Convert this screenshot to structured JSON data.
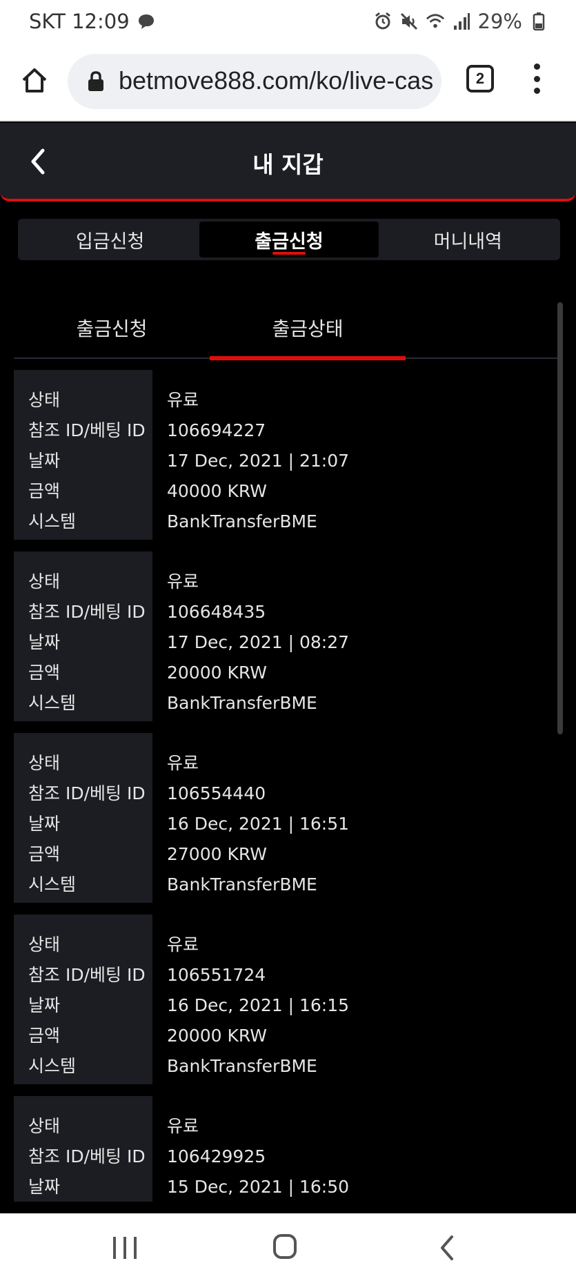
{
  "status_bar": {
    "carrier_time": "SKT 12:09",
    "battery": "29%",
    "icons": [
      "message-icon",
      "alarm-icon",
      "mute-icon",
      "wifi-icon",
      "signal-icon",
      "battery-icon"
    ]
  },
  "browser": {
    "url": "betmove888.com/ko/live-cas",
    "tab_count": "2",
    "icons": [
      "home-icon",
      "lock-icon",
      "menu-icon"
    ]
  },
  "header": {
    "title": "내 지갑",
    "back_icon": "chevron-left-icon"
  },
  "main_tabs": [
    {
      "label": "입금신청",
      "active": false
    },
    {
      "label": "출금신청",
      "active": true
    },
    {
      "label": "머니내역",
      "active": false
    }
  ],
  "sub_tabs": [
    {
      "label": "출금신청",
      "active": false
    },
    {
      "label": "출금상태",
      "active": true
    }
  ],
  "field_labels": {
    "status": "상태",
    "ref_id": "참조 ID/베팅 ID",
    "date": "날짜",
    "amount": "금액",
    "system": "시스템"
  },
  "records": [
    {
      "status": "유료",
      "ref_id": "106694227",
      "date": "17 Dec, 2021 | 21:07",
      "amount": "40000 KRW",
      "system": "BankTransferBME"
    },
    {
      "status": "유료",
      "ref_id": "106648435",
      "date": "17 Dec, 2021 | 08:27",
      "amount": "20000 KRW",
      "system": "BankTransferBME"
    },
    {
      "status": "유료",
      "ref_id": "106554440",
      "date": "16 Dec, 2021 | 16:51",
      "amount": "27000 KRW",
      "system": "BankTransferBME"
    },
    {
      "status": "유료",
      "ref_id": "106551724",
      "date": "16 Dec, 2021 | 16:15",
      "amount": "20000 KRW",
      "system": "BankTransferBME"
    },
    {
      "status": "유료",
      "ref_id": "106429925",
      "date": "15 Dec, 2021 | 16:50",
      "amount": "",
      "system": ""
    }
  ],
  "colors": {
    "accent": "#e00d0d",
    "panel": "#1c1d22",
    "background": "#000000"
  }
}
